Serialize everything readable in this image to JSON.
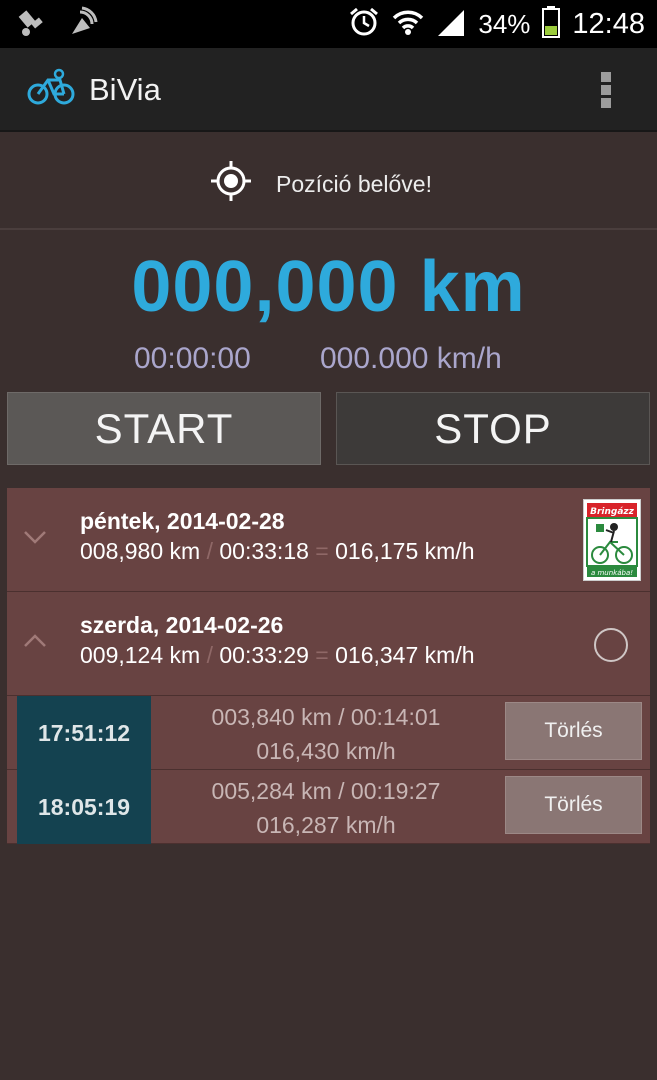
{
  "status_bar": {
    "battery_percent": "34%",
    "time": "12:48",
    "icons": [
      "gps-icon",
      "satellite-icon",
      "alarm-icon",
      "wifi-icon",
      "signal-icon",
      "battery-icon"
    ]
  },
  "app": {
    "title": "BiVia",
    "accent": "#2eaadc"
  },
  "gps": {
    "status": "Pozíció belőve!"
  },
  "tracker": {
    "distance": "000,000 km",
    "elapsed": "00:00:00",
    "speed": "000.000 km/h",
    "start_label": "START",
    "stop_label": "STOP"
  },
  "history": {
    "days": [
      {
        "date": "péntek, 2014-02-28",
        "distance": "008,980 km",
        "duration": "00:33:18",
        "speed": "016,175 km/h",
        "badge_text_top": "Bringázz",
        "badge_text_bottom": "a munkába!"
      },
      {
        "date": "szerda, 2014-02-26",
        "distance": "009,124 km",
        "duration": "00:33:29",
        "speed": "016,347 km/h"
      }
    ],
    "separators": {
      "slash": "/",
      "equals": "="
    },
    "laps": [
      {
        "start": "17:51:12",
        "line1": "003,840 km / 00:14:01",
        "line2": "016,430 km/h",
        "delete_label": "Törlés"
      },
      {
        "start": "18:05:19",
        "line1": "005,284 km / 00:19:27",
        "line2": "016,287 km/h",
        "delete_label": "Törlés"
      }
    ]
  }
}
